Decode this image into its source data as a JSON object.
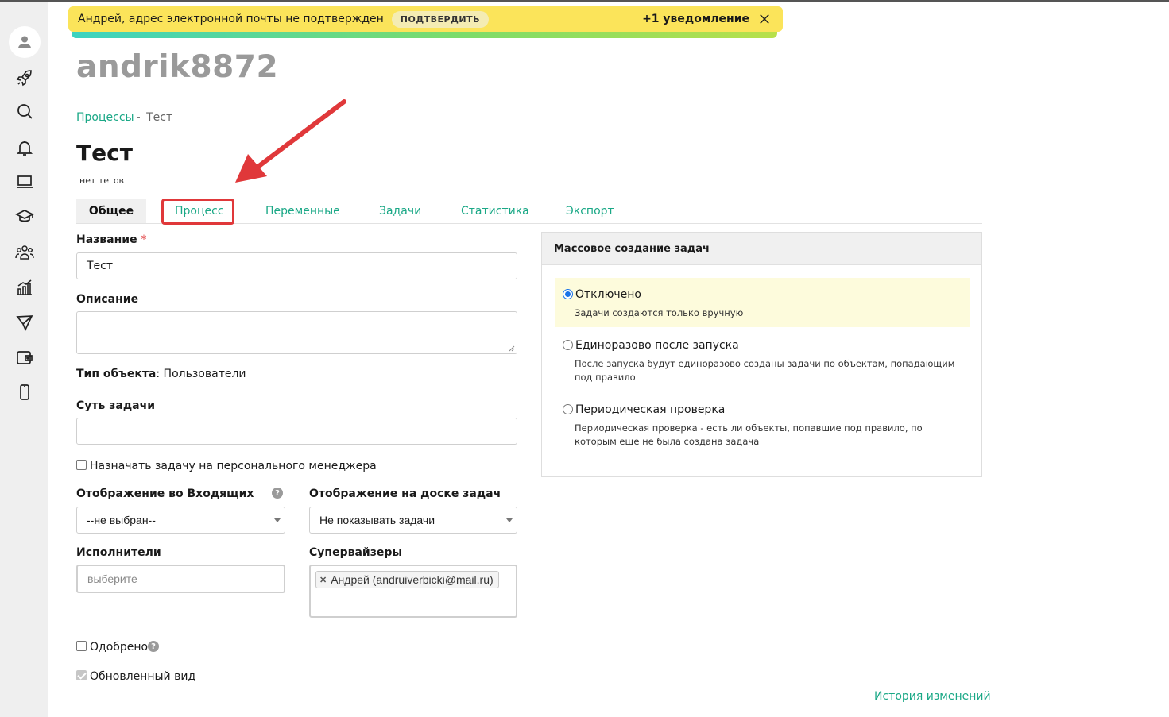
{
  "notification": {
    "message": "Андрей, адрес электронной почты не подтвержден",
    "confirm_label": "ПОДТВЕРДИТЬ",
    "count_label": "+1 уведомление"
  },
  "username": "andrik8872",
  "breadcrumb": {
    "parent": "Процессы",
    "separator": "-",
    "current": "Тест"
  },
  "page": {
    "title": "Тест",
    "tags": "нет тегов"
  },
  "tabs": [
    {
      "label": "Общее"
    },
    {
      "label": "Процесс"
    },
    {
      "label": "Переменные"
    },
    {
      "label": "Задачи"
    },
    {
      "label": "Статистика"
    },
    {
      "label": "Экспорт"
    }
  ],
  "form": {
    "name_label": "Название",
    "required_mark": "*",
    "name_value": "Тест",
    "description_label": "Описание",
    "object_type_label": "Тип объекта",
    "object_type_value": ": Пользователи",
    "essence_label": "Суть задачи",
    "assign_manager_label": "Назначать задачу на персонального менеджера",
    "inbox_display_label": "Отображение во Входящих",
    "inbox_display_value": "--не выбран--",
    "board_display_label": "Отображение на доске задач",
    "board_display_value": "Не показывать задачи",
    "executors_label": "Исполнители",
    "executors_placeholder": "выберите",
    "supervisors_label": "Супервайзеры",
    "supervisor_chip": "Андрей (andruiverbicki@mail.ru)",
    "approved_label": "Одобрено",
    "updated_view_label": "Обновленный вид",
    "help_glyph": "?"
  },
  "mass_creation": {
    "title": "Массовое создание задач",
    "options": [
      {
        "title": "Отключено",
        "description": "Задачи создаются только вручную",
        "selected": true
      },
      {
        "title": "Единоразово после запуска",
        "description": "После запуска будут единоразово созданы задачи по объектам, попадающим под правило",
        "selected": false
      },
      {
        "title": "Периодическая проверка",
        "description": "Периодическая проверка - есть ли объекты, попавшие под правило, по которым еще не была создана задача",
        "selected": false
      }
    ]
  },
  "history_link": "История изменений",
  "colors": {
    "accent": "#1aa886",
    "notice_bg": "#fbe45a",
    "highlight": "#e0383a"
  }
}
